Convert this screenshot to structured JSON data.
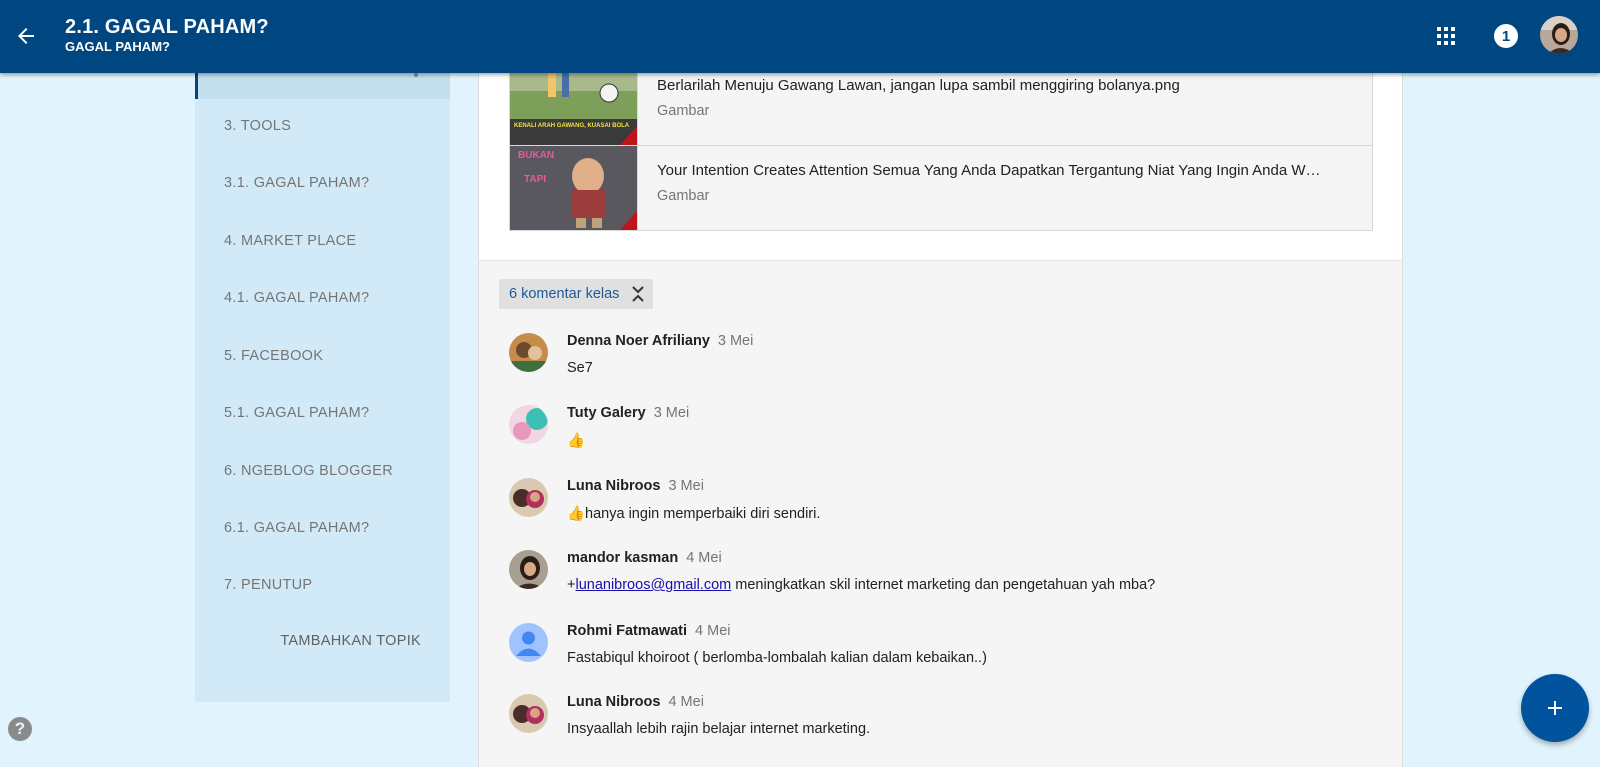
{
  "header": {
    "title": "2.1. GAGAL PAHAM?",
    "subtitle": "GAGAL PAHAM?",
    "notification_count": "1",
    "icons": {
      "back": "arrow-back-icon",
      "apps": "apps-grid-icon",
      "account": "account-avatar"
    }
  },
  "sidebar": {
    "items": [
      {
        "label": "3. TOOLS"
      },
      {
        "label": "3.1. GAGAL PAHAM?"
      },
      {
        "label": "4. MARKET PLACE"
      },
      {
        "label": "4.1. GAGAL PAHAM?"
      },
      {
        "label": "5. FACEBOOK"
      },
      {
        "label": "5.1. GAGAL PAHAM?"
      },
      {
        "label": "6. NGEBLOG BLOGGER"
      },
      {
        "label": "6.1. GAGAL PAHAM?"
      },
      {
        "label": "7. PENUTUP"
      }
    ],
    "add_topic_label": "TAMBAHKAN TOPIK"
  },
  "attachments": [
    {
      "name": "Berlarilah Menuju Gawang Lawan, jangan lupa sambil menggiring bolanya.png",
      "kind": "Gambar",
      "thumb_text": "KENALI ARAH GAWANG, KUASAI BOLA"
    },
    {
      "name": "Your Intention Creates Attention Semua Yang Anda Dapatkan Tergantung Niat Yang Ingin Anda W…",
      "kind": "Gambar",
      "thumb_text_top": "BUKAN",
      "thumb_text_mid": "TAPI"
    }
  ],
  "comments_section": {
    "toggle_label": "6 komentar kelas",
    "comments": [
      {
        "author": "Denna Noer Afriliany",
        "date": "3 Mei",
        "text": "Se7"
      },
      {
        "author": "Tuty Galery",
        "date": "3 Mei",
        "text": "👍"
      },
      {
        "author": "Luna Nibroos",
        "date": "3 Mei",
        "text": "👍hanya ingin memperbaiki diri sendiri."
      },
      {
        "author": "mandor kasman",
        "date": "4 Mei",
        "prefix": "+",
        "link": "lunanibroos@gmail.com",
        "text": " meningkatkan skil internet marketing dan pengetahuan yah mba?"
      },
      {
        "author": "Rohmi Fatmawati",
        "date": "4 Mei",
        "text": "Fastabiqul khoiroot ( berlomba-lombalah kalian dalam kebaikan..)"
      },
      {
        "author": "Luna Nibroos",
        "date": "4 Mei",
        "text": "Insyaallah lebih rajin belajar internet marketing."
      }
    ]
  },
  "colors": {
    "appbar": "#004680",
    "background": "#e1f4fd",
    "sidebar": "#d2eaf7",
    "fab": "#00539c",
    "link": "#1a0dab"
  },
  "fab_icon": "plus-icon",
  "help_icon": "help-icon",
  "help_glyph": "?"
}
